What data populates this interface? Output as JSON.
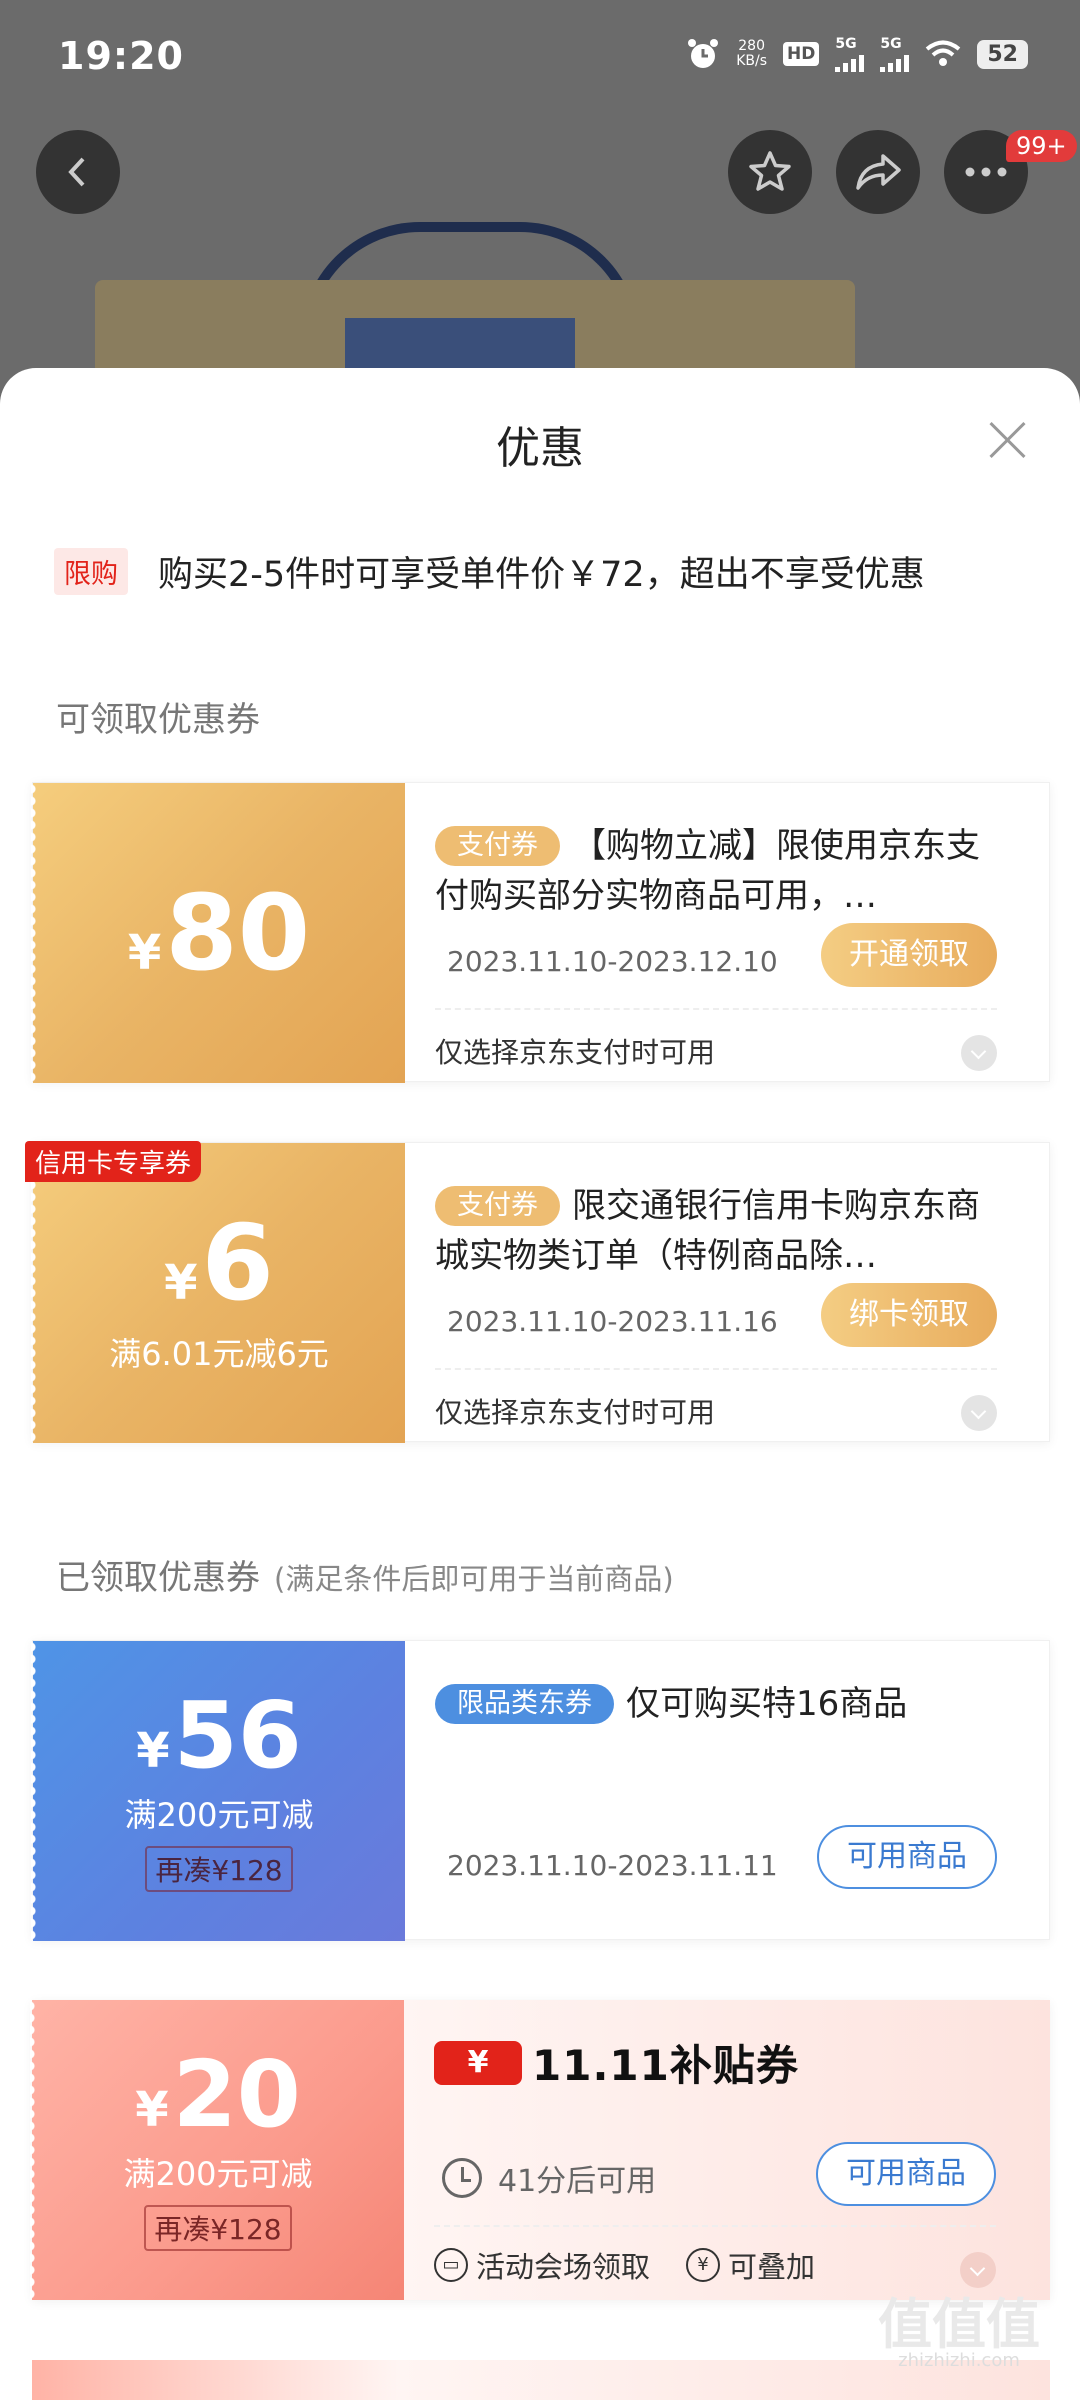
{
  "status_bar": {
    "time": "19:20",
    "net_speed_value": "280",
    "net_speed_unit": "KB/s",
    "hd": "HD",
    "signal1": "5G",
    "signal2": "5G",
    "battery": "52"
  },
  "header": {
    "notification_badge": "99+"
  },
  "sheet": {
    "title": "优惠",
    "limit": {
      "tag": "限购",
      "text": "购买2-5件时可享受单件价￥72，超出不享受优惠"
    },
    "available_section": "可领取优惠券",
    "claimed_section": "已领取优惠券",
    "claimed_subtitle": "(满足条件后即可用于当前商品)"
  },
  "coupons": [
    {
      "currency": "¥",
      "amount": "80",
      "tag": "支付券",
      "title": "【购物立减】限使用京东支付购买部分实物商品可用，…",
      "date": "2023.11.10-2023.12.10",
      "button": "开通领取",
      "note": "仅选择京东支付时可用"
    },
    {
      "corner": "信用卡专享券",
      "currency": "¥",
      "amount": "6",
      "condition": "满6.01元减6元",
      "tag": "支付券",
      "title": "限交通银行信用卡购京东商城实物类订单（特例商品除…",
      "date": "2023.11.10-2023.11.16",
      "button": "绑卡领取",
      "note": "仅选择京东支付时可用"
    },
    {
      "currency": "¥",
      "amount": "56",
      "condition": "满200元可减",
      "add_more": "再凑¥128",
      "tag": "限品类东券",
      "title": "仅可购买特16商品",
      "date": "2023.11.10-2023.11.11",
      "button": "可用商品"
    },
    {
      "currency": "¥",
      "amount": "20",
      "condition": "满200元可减",
      "add_more": "再凑¥128",
      "logo_yen": "¥",
      "logo_text": "11.11补贴券",
      "timer": "41分后可用",
      "button": "可用商品",
      "feature1": "活动会场领取",
      "feature2": "可叠加"
    }
  ],
  "watermark": {
    "main": "值值值",
    "sub": "zhizhizhi.com"
  }
}
